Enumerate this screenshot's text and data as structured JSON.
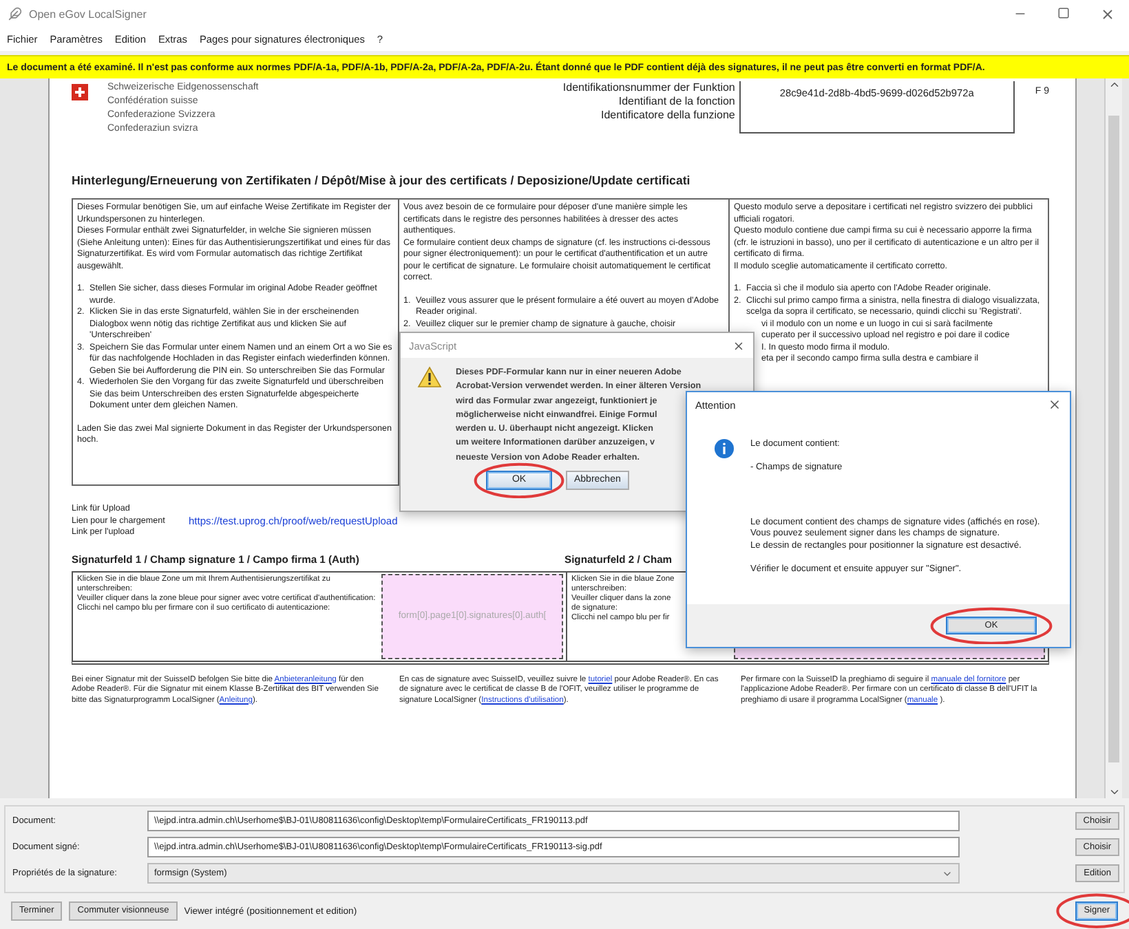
{
  "window": {
    "title": "Open eGov LocalSigner"
  },
  "menu": [
    "Fichier",
    "Paramètres",
    "Edition",
    "Extras",
    "Pages pour signatures électroniques",
    "?"
  ],
  "banner": "Le document a été examiné. Il n'est pas conforme aux normes PDF/A-1a, PDF/A-1b, PDF/A-2a, PDF/A-2a, PDF/A-2u. Étant donné que le PDF contient déjà des signatures, il ne peut pas être converti en format PDF/A.",
  "document": {
    "header": {
      "org_lines": [
        "Schweizerische Eidgenossenschaft",
        "Confédération suisse",
        "Confederazione Svizzera",
        "Confederaziun svizra"
      ],
      "id_labels": [
        "Identifikationsnummer der Funktion",
        "Identifiant de la fonction",
        "Identificatore della funzione"
      ],
      "id_value": "28c9e41d-2d8b-4bd5-9699-d026d52b972a",
      "page_mark": "F 9"
    },
    "title": "Hinterlegung/Erneuerung von Zertifikaten /  Dépôt/Mise à jour des certificats / Deposizione/Update certificati",
    "columns": [
      {
        "paragraphs": [
          "Dieses Formular benötigen Sie, um auf einfache Weise Zertifikate im Register der Urkundspersonen zu hinterlegen.",
          "Dieses Formular enthält zwei Signaturfelder, in welche Sie signieren müssen (Siehe Anleitung unten): Eines für das Authentisierungszertifikat und eines für das Signaturzertifikat. Es wird vom Formular automatisch das richtige Zertifikat ausgewählt."
        ],
        "steps": [
          {
            "number": "1.",
            "text": "Stellen Sie sicher, dass dieses Formular im original Adobe Reader geöffnet wurde."
          },
          {
            "number": "2.",
            "text": "Klicken Sie in das erste Signaturfeld, wählen Sie in der erscheinenden Dialogbox wenn nötig das richtige Zertifikat aus und klicken Sie auf 'Unterschreiben'"
          },
          {
            "number": "3.",
            "text": "Speichern Sie das Formular unter einem Namen und an einem Ort a wo Sie es für das nachfolgende Hochladen in das Register einfach wiederfinden können. Geben Sie bei Aufforderung die PIN ein. So unterschreiben Sie das Formular"
          },
          {
            "number": "4.",
            "text": "Wiederholen Sie den Vorgang für das zweite Signaturfeld und überschreiben Sie das beim Unterschreiben des ersten Signaturfelde abgespeicherte Dokument unter dem gleichen Namen."
          }
        ],
        "closing": [
          "Laden Sie das zwei Mal signierte Dokument in das Register der Urkundspersonen hoch."
        ]
      },
      {
        "paragraphs": [
          "Vous avez besoin de ce formulaire pour déposer d'une manière simple les certificats dans le registre des personnes habilitées à dresser des actes authentiques.",
          "Ce formulaire contient deux champs de signature (cf. les instructions ci-dessous pour signer électroniquement): un pour le certificat d'authentification et un autre pour le certificat de signature. Le formulaire choisit automatiquement le certificat correct."
        ],
        "steps": [
          {
            "number": "1.",
            "text": "Veuillez vous assurer que le présent formulaire a été ouvert au moyen d'Adobe Reader original."
          },
          {
            "number": "2.",
            "text": "Veuillez cliquer sur le premier champ de signature à gauche, choisir"
          }
        ]
      },
      {
        "paragraphs": [
          "Questo modulo serve a depositare i certificati nel registro svizzero dei pubblici ufficiali rogatori.",
          "Questo modulo contiene due campi firma su cui è necessario apporre la firma (cfr. le istruzioni in basso), uno per il certificato di autenticazione e un altro per il certificato di firma.",
          "Il modulo sceglie automaticamente il certificato corretto."
        ],
        "steps": [
          {
            "number": "1.",
            "text": "Faccia sì che il modulo sia aperto con l'Adobe Reader originale."
          },
          {
            "number": "2.",
            "text": "Clicchi sul primo campo firma a sinistra, nella finestra di dialogo visualizzata, scelga da sopra il certificato, se necessario, quindi clicchi su 'Registrati'."
          }
        ],
        "fragments": [
          "vi il modulo con un nome e un luogo in cui si sarà facilmente",
          "cuperato per il successivo upload nel registro e poi dare il codice",
          "I. In questo modo firma il modulo.",
          "eta per il secondo campo firma sulla destra e cambiare il"
        ]
      }
    ],
    "upload": {
      "labels": [
        "Link für Upload",
        "Lien pour le chargement",
        "Link per l'upload"
      ],
      "url": "https://test.uprog.ch/proof/web/requestUpload"
    },
    "signature_fields": [
      {
        "title": "Signaturfeld 1 / Champ signature 1 / Campo firma 1  (Auth)",
        "lines": [
          "Klicken Sie in die blaue Zone um mit Ihrem Authentisierungszertifikat zu unterschreiben:",
          "Veuiller cliquer dans la zone bleue pour signer avec votre certificat d'authentification:",
          "Clicchi nel campo blu per firmare con il suo certificato di autenticazione:"
        ],
        "field_name": "form[0].page1[0].signatures[0].auth["
      },
      {
        "title": "Signaturfeld 2 / Cham",
        "lines": [
          "Klicken Sie in die blaue Zone",
          "unterschreiben:",
          "Veuiller cliquer dans la zone",
          "de signature:",
          "Clicchi nel campo blu per fir"
        ]
      }
    ],
    "footer_notes": [
      [
        {
          "kind": "text",
          "text": "Bei einer Signatur mit der SuisseID befolgen Sie bitte die "
        },
        {
          "kind": "link",
          "text": "Anbieteranleitung"
        },
        {
          "kind": "text",
          "text": " für den Adobe Reader®. Für die Signatur mit einem Klasse B-Zertifikat des BIT verwenden Sie bitte das Signaturprogramm LocalSigner ("
        },
        {
          "kind": "link",
          "text": "Anleitung"
        },
        {
          "kind": "text",
          "text": ")."
        }
      ],
      [
        {
          "kind": "text",
          "text": "En cas de signature avec SuisseID, veuillez suivre le "
        },
        {
          "kind": "link",
          "text": "tutoriel"
        },
        {
          "kind": "text",
          "text": "  pour Adobe Reader®. En cas de signature avec le certificat de classe B de l'OFIT, veuillez utiliser le programme de signature LocalSigner ("
        },
        {
          "kind": "link",
          "text": "Instructions d'utilisation"
        },
        {
          "kind": "text",
          "text": ")."
        }
      ],
      [
        {
          "kind": "text",
          "text": "Per firmare con la SuisseID la preghiamo di seguire il "
        },
        {
          "kind": "link",
          "text": "manuale del fornitore"
        },
        {
          "kind": "text",
          "text": " per l'applicazione Adobe Reader®. Per firmare con un certificato di classe B dell'UFIT la preghiamo di usare il programma LocalSigner ("
        },
        {
          "kind": "link",
          "text": "manuale"
        },
        {
          "kind": "text",
          "text": " )."
        }
      ]
    ]
  },
  "js_dialog": {
    "title": "JavaScript",
    "lines": [
      "Dieses PDF-Formular kann nur in einer neueren Adobe",
      "Acrobat-Version verwendet werden. In einer älteren Version",
      "wird das Formular zwar angezeigt, funktioniert je",
      "möglicherweise nicht einwandfrei. Einige Formul",
      "werden u. U. überhaupt nicht angezeigt. Klicken",
      "um weitere Informationen darüber anzuzeigen, v",
      "neueste Version von Adobe Reader erhalten."
    ],
    "buttons": [
      {
        "label": "OK",
        "focused": true,
        "circled": true
      },
      {
        "label": "Abbrechen",
        "focused": false,
        "circled": false
      }
    ]
  },
  "attention_dialog": {
    "title": "Attention",
    "blocks": [
      [
        "Le document contient:"
      ],
      [
        "- Champs de signature"
      ],
      [
        "Le document contient des champs de signature vides (affichés en rose).",
        "Vous pouvez seulement signer dans les champs de signature.",
        "Le dessin de rectangles pour positionner la signature est desactivé."
      ],
      [
        "Vérifier le document et ensuite appuyer sur \"Signer\"."
      ]
    ],
    "buttons": [
      {
        "label": "OK",
        "focused": true,
        "circled": true
      }
    ]
  },
  "form": [
    {
      "kind": "text",
      "label": "Document:",
      "value": "\\\\ejpd.intra.admin.ch\\Userhome$\\BJ-01\\U80811636\\config\\Desktop\\temp\\FormulaireCertificats_FR190113.pdf",
      "button": "Choisir"
    },
    {
      "kind": "text",
      "label": "Document signé:",
      "value": "\\\\ejpd.intra.admin.ch\\Userhome$\\BJ-01\\U80811636\\config\\Desktop\\temp\\FormulaireCertificats_FR190113-sig.pdf",
      "button": "Choisir"
    },
    {
      "kind": "select",
      "label": "Propriétés de la signature:",
      "value": "formsign (System)",
      "button": "Edition"
    }
  ],
  "bottom_bar": {
    "buttons": [
      {
        "label": "Terminer",
        "focused": false,
        "circled": false
      },
      {
        "label": "Commuter visionneuse",
        "focused": false,
        "circled": false
      }
    ],
    "status": "Viewer intégré (positionnement et edition)",
    "actions": [
      {
        "label": "Signer",
        "focused": true,
        "circled": true
      }
    ]
  }
}
